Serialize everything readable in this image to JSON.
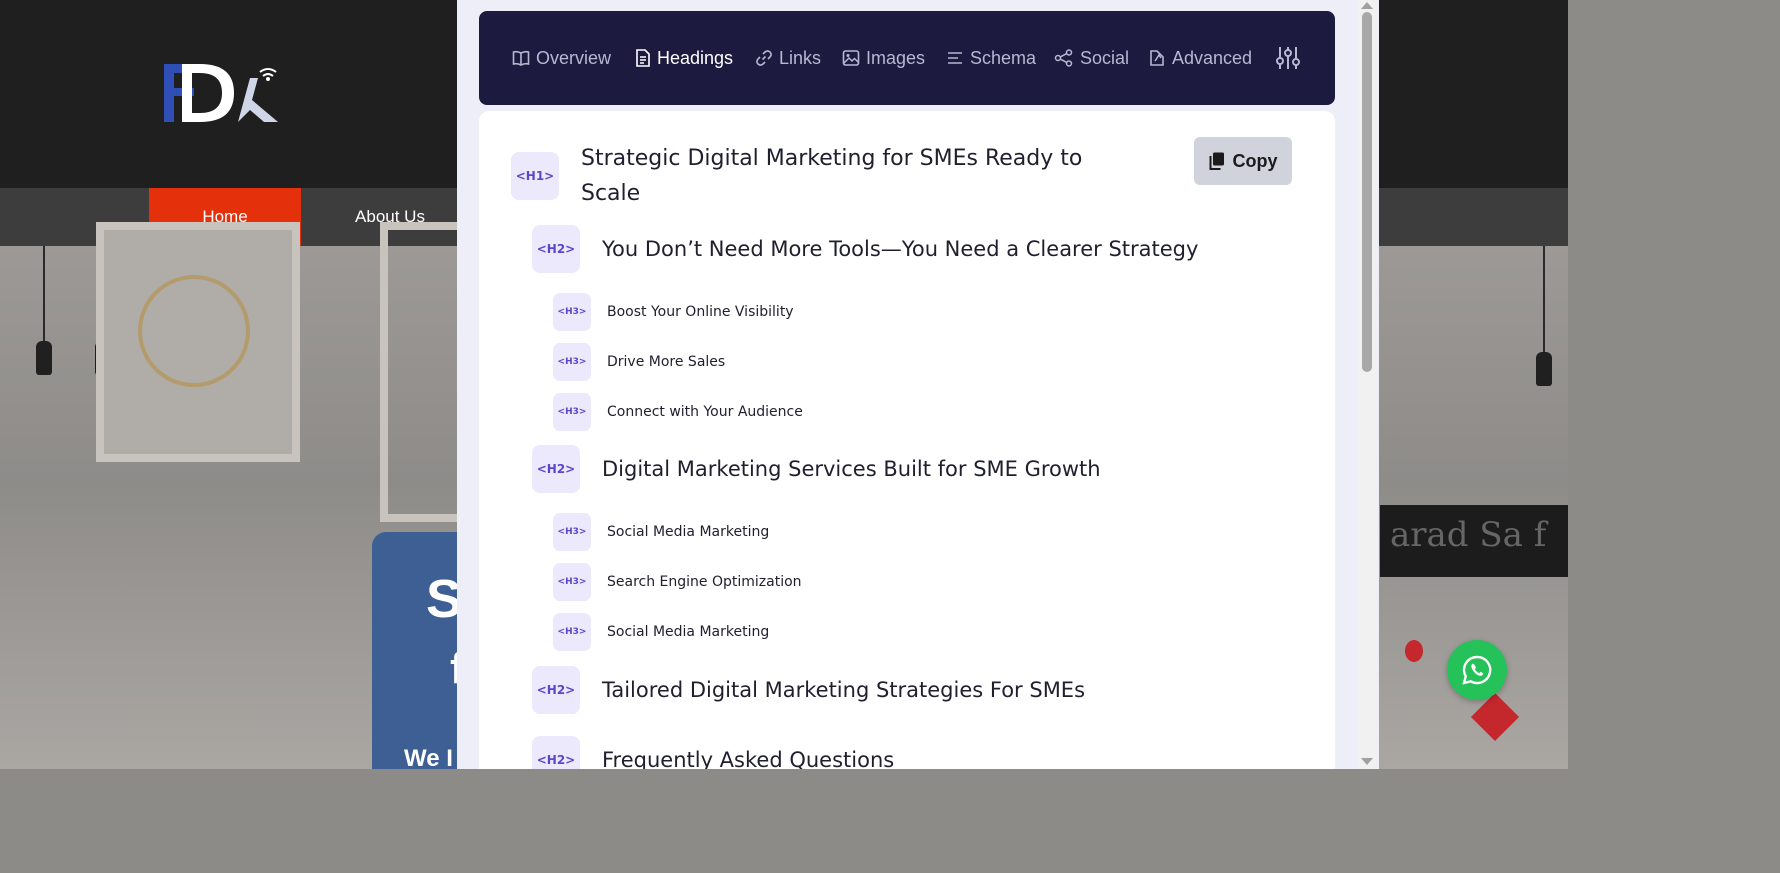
{
  "site": {
    "nav": {
      "home": "Home",
      "about": "About Us"
    },
    "hero_partial": {
      "letter_s": "S",
      "letter_f": "f",
      "tagline": "We I"
    },
    "decor_text": "arad Sa f"
  },
  "extension": {
    "tabs": [
      {
        "label": "Overview",
        "icon": "book-icon"
      },
      {
        "label": "Headings",
        "icon": "document-icon",
        "active": true
      },
      {
        "label": "Links",
        "icon": "link-icon"
      },
      {
        "label": "Images",
        "icon": "image-icon"
      },
      {
        "label": "Schema",
        "icon": "schema-icon"
      },
      {
        "label": "Social",
        "icon": "share-icon"
      },
      {
        "label": "Advanced",
        "icon": "advanced-icon"
      }
    ],
    "settings_icon": "sliders-icon",
    "copy_label": "Copy",
    "headings": [
      {
        "tag": "<H1>",
        "text": "Strategic Digital Marketing for SMEs Ready to Scale"
      },
      {
        "tag": "<H2>",
        "text": "You Don’t Need More Tools—You Need a Clearer Strategy"
      },
      {
        "tag": "<H3>",
        "text": "Boost Your Online Visibility"
      },
      {
        "tag": "<H3>",
        "text": "Drive More Sales"
      },
      {
        "tag": "<H3>",
        "text": "Connect with Your Audience"
      },
      {
        "tag": "<H2>",
        "text": "Digital Marketing Services Built for SME Growth"
      },
      {
        "tag": "<H3>",
        "text": "Social Media Marketing"
      },
      {
        "tag": "<H3>",
        "text": "Search Engine Optimization"
      },
      {
        "tag": "<H3>",
        "text": "Social Media Marketing"
      },
      {
        "tag": "<H2>",
        "text": "Tailored Digital Marketing Strategies For SMEs"
      },
      {
        "tag": "<H2>",
        "text": "Frequently Asked Questions"
      }
    ]
  },
  "colors": {
    "accent": "#e4300b",
    "tabbar_bg": "#1c1a3f",
    "tag_bg": "#ece9fc",
    "tag_text": "#5b48c9",
    "whatsapp": "#25c25a"
  }
}
